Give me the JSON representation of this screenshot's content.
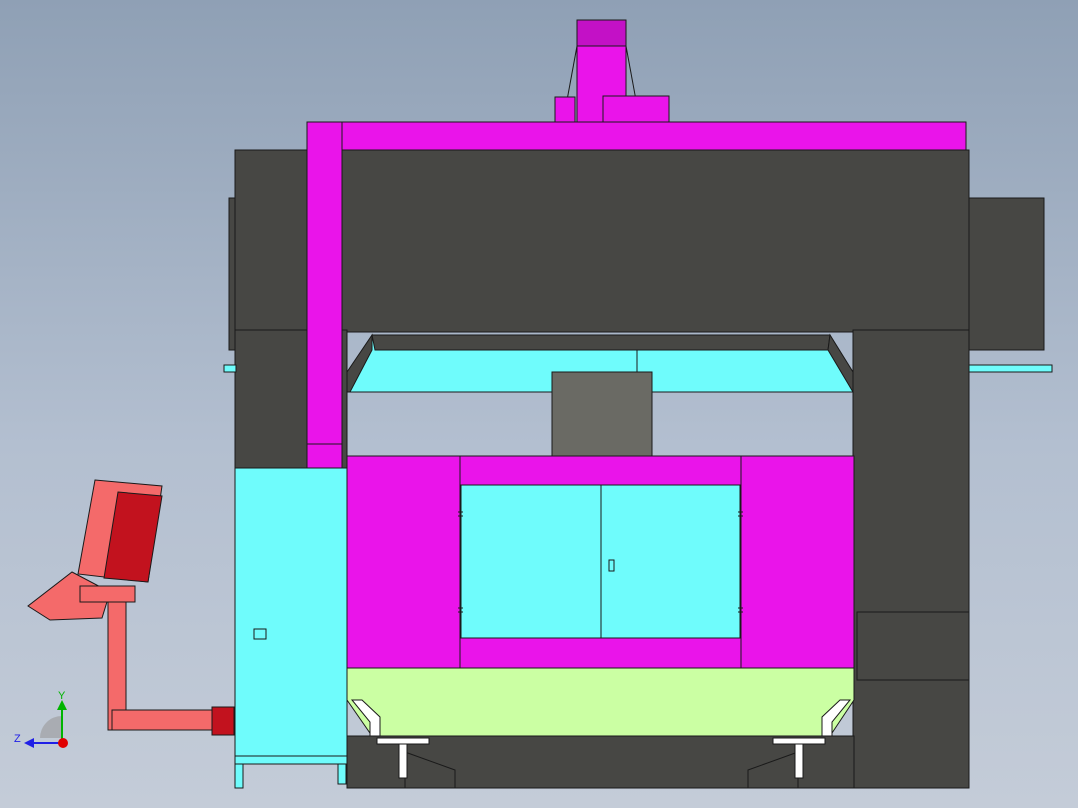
{
  "colors": {
    "dark": "#474744",
    "shaft": "#6a6a64",
    "magenta": "#ea14ea",
    "magenta_shade": "#c311c6",
    "cyan": "#6ffcfc",
    "green": "#cbffa3",
    "red": "#f46a6a",
    "red_dark": "#c2121e",
    "outline": "#1a1a1a"
  },
  "triad": {
    "y_label": "Y",
    "z_label": "Z",
    "y_color": "#00b400",
    "z_color": "#2020e6",
    "x_color": "#e00000"
  }
}
